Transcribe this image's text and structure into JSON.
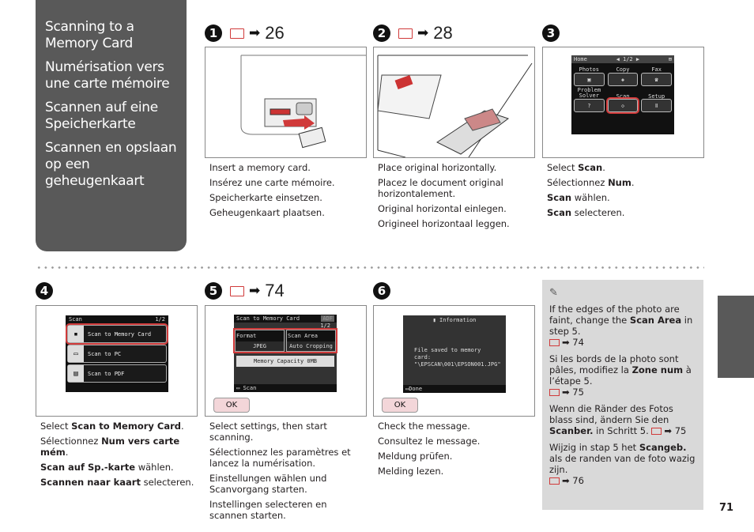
{
  "title_box": [
    "Scanning to a Memory Card",
    "Numérisation vers une carte mémoire",
    "Scannen auf eine Speicherkarte",
    "Scannen en opslaan op een geheugenkaart"
  ],
  "steps": [
    {
      "num": "1",
      "page": "26",
      "text": [
        [
          {
            "t": "Insert a memory card."
          }
        ],
        [
          {
            "t": "Insérez une carte mémoire."
          }
        ],
        [
          {
            "t": "Speicherkarte einsetzen."
          }
        ],
        [
          {
            "t": "Geheugenkaart plaatsen."
          }
        ]
      ]
    },
    {
      "num": "2",
      "page": "28",
      "text": [
        [
          {
            "t": "Place original horizontally."
          }
        ],
        [
          {
            "t": "Placez le document original horizontalement."
          }
        ],
        [
          {
            "t": "Original horizontal einlegen."
          }
        ],
        [
          {
            "t": "Origineel horizontaal leggen."
          }
        ]
      ]
    },
    {
      "num": "3",
      "text": [
        [
          {
            "t": "Select "
          },
          {
            "t": "Scan",
            "b": true
          },
          {
            "t": "."
          }
        ],
        [
          {
            "t": "Sélectionnez "
          },
          {
            "t": "Num",
            "b": true
          },
          {
            "t": "."
          }
        ],
        [
          {
            "t": "Scan",
            "b": true
          },
          {
            "t": " wählen."
          }
        ],
        [
          {
            "t": "Scan",
            "b": true
          },
          {
            "t": " selecteren."
          }
        ]
      ]
    },
    {
      "num": "4",
      "text": [
        [
          {
            "t": "Select "
          },
          {
            "t": "Scan to Memory Card",
            "b": true
          },
          {
            "t": "."
          }
        ],
        [
          {
            "t": "Sélectionnez "
          },
          {
            "t": "Num vers carte mém",
            "b": true
          },
          {
            "t": "."
          }
        ],
        [
          {
            "t": "Scan auf Sp.-karte",
            "b": true
          },
          {
            "t": " wählen."
          }
        ],
        [
          {
            "t": "Scannen naar kaart",
            "b": true
          },
          {
            "t": " selecteren."
          }
        ]
      ]
    },
    {
      "num": "5",
      "page": "74",
      "text": [
        [
          {
            "t": "Select settings, then start scanning."
          }
        ],
        [
          {
            "t": "Sélectionnez les paramètres et lancez la numérisation."
          }
        ],
        [
          {
            "t": "Einstellungen wählen und Scanvorgang starten."
          }
        ],
        [
          {
            "t": "Instellingen selecteren en scannen starten."
          }
        ]
      ]
    },
    {
      "num": "6",
      "text": [
        [
          {
            "t": "Check the message."
          }
        ],
        [
          {
            "t": "Consultez le message."
          }
        ],
        [
          {
            "t": "Meldung prüfen."
          }
        ],
        [
          {
            "t": "Melding lezen."
          }
        ]
      ]
    }
  ],
  "screen3": {
    "title": "Home",
    "pager": "◀ 1/2 ▶",
    "items": [
      "Photos",
      "Copy",
      "Fax",
      "Problem Solver",
      "Scan",
      "Setup"
    ]
  },
  "screen4": {
    "title": "Scan",
    "pager": "1/2",
    "items": [
      "Scan to Memory Card",
      "Scan to PC",
      "Scan to PDF"
    ]
  },
  "screen5": {
    "title": "Scan to Memory Card",
    "badge": "ADF",
    "pager": "1/2",
    "format_label": "Format",
    "format_value": "JPEG",
    "area_label": "Scan Area",
    "area_value": "Auto Cropping",
    "capacity": "Memory Capacity 0MB",
    "footer": "Scan",
    "ok": "OK"
  },
  "screen6": {
    "title": "Information",
    "message": "File saved to memory card:",
    "path": "\"\\EPSCAN\\001\\EPSON001.JPG\"",
    "footer": "Done",
    "ok": "OK"
  },
  "note": [
    {
      "segs": [
        {
          "t": "If the edges of the photo are faint, change the "
        },
        {
          "t": "Scan Area",
          "b": true
        },
        {
          "t": " in step 5."
        }
      ],
      "page": "74"
    },
    {
      "segs": [
        {
          "t": "Si les bords de la photo sont pâles, modifiez la "
        },
        {
          "t": "Zone num",
          "b": true
        },
        {
          "t": " à l’étape 5."
        }
      ],
      "page": "75"
    },
    {
      "segs": [
        {
          "t": "Wenn die Ränder des Fotos blass sind, ändern Sie den "
        },
        {
          "t": "Scanber.",
          "b": true
        },
        {
          "t": " in Schritt 5."
        }
      ],
      "page": "75",
      "inline": true
    },
    {
      "segs": [
        {
          "t": "Wijzig in stap 5 het "
        },
        {
          "t": "Scangeb.",
          "b": true
        },
        {
          "t": " als de randen van de foto wazig zijn."
        }
      ],
      "page": "76"
    }
  ],
  "page_number": "71",
  "colors": {
    "dark_gray": "#595959",
    "note_bg": "#d9d9d9",
    "highlight_red": "#d03a3a",
    "ok_pink": "#f3d6d9"
  }
}
